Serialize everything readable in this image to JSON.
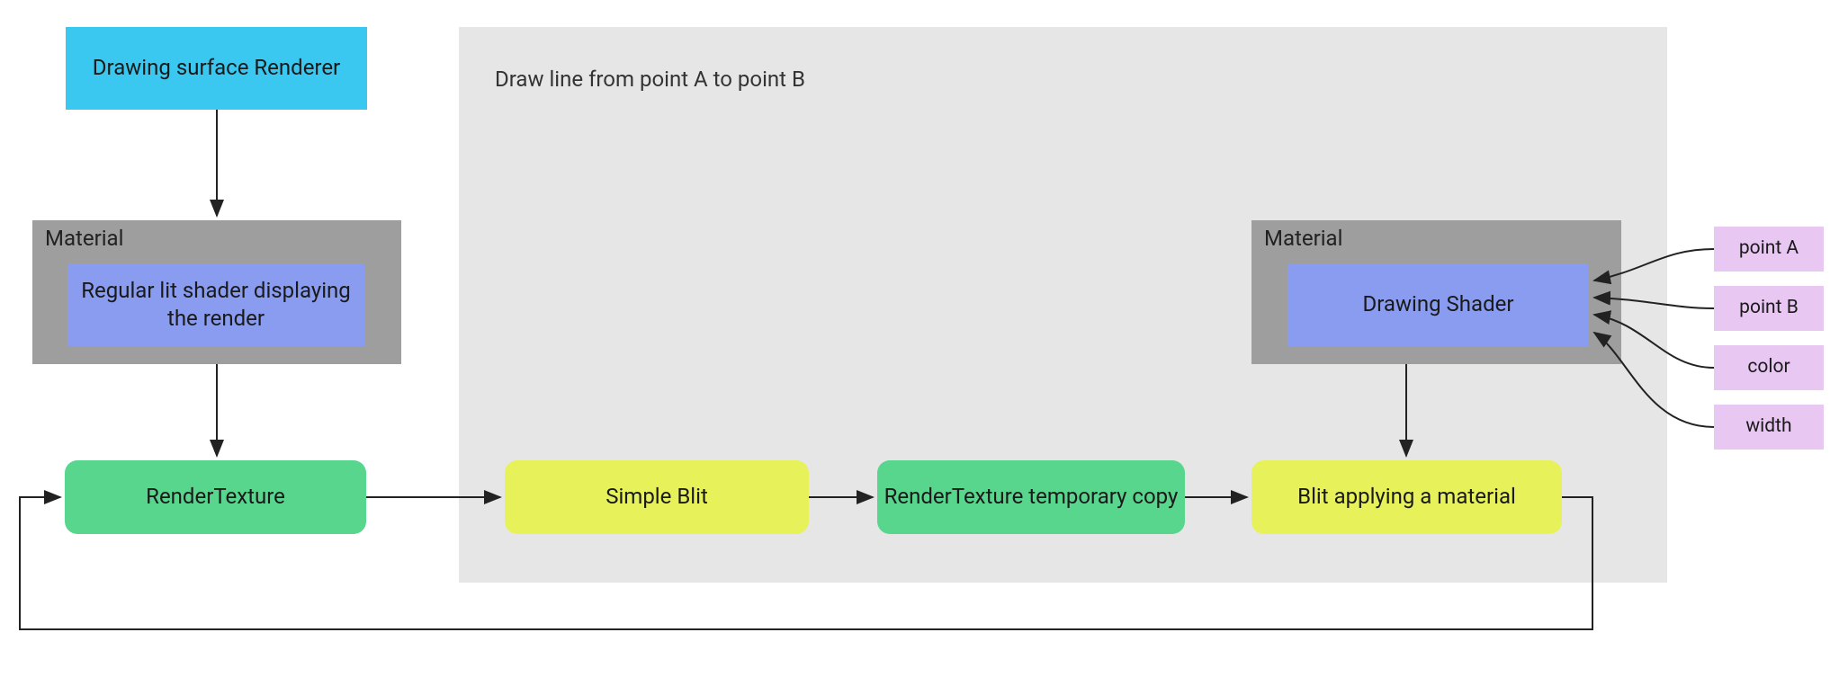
{
  "nodes": {
    "drawing_surface": "Drawing surface Renderer",
    "material_label": "Material",
    "lit_shader": "Regular lit shader displaying the render",
    "render_texture": "RenderTexture",
    "group_title": "Draw line from point A to point B",
    "simple_blit": "Simple Blit",
    "rt_temp_copy": "RenderTexture temporary copy",
    "blit_apply": "Blit applying a material",
    "drawing_shader": "Drawing Shader",
    "param_point_a": "point A",
    "param_point_b": "point B",
    "param_color": "color",
    "param_width": "width"
  },
  "colors": {
    "cyan": "#3ac8f0",
    "blue": "#8a9cf0",
    "green": "#58d68d",
    "yellow": "#e7f25a",
    "pink": "#e8c8f2",
    "grey_dark": "#9e9e9e",
    "grey_light": "#e6e6e6"
  }
}
